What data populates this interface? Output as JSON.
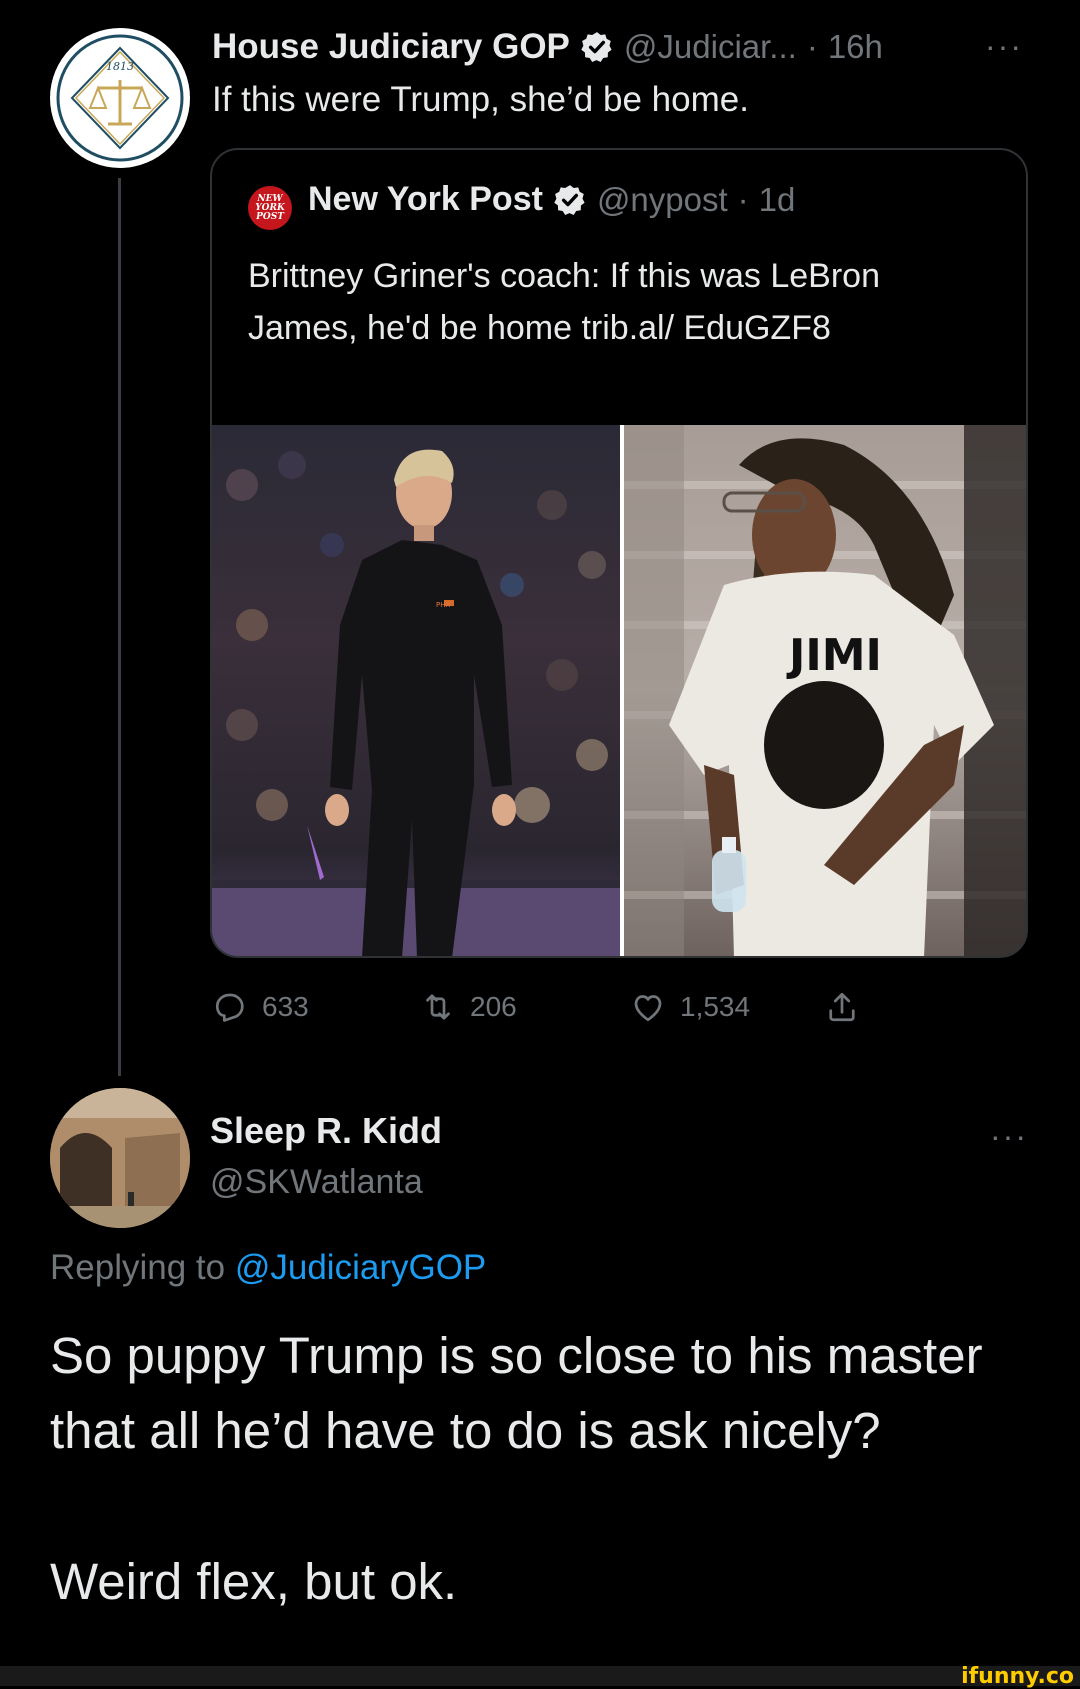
{
  "tweet": {
    "name": "House Judiciary GOP",
    "handle": "@Judiciar...",
    "separator": "·",
    "time": "16h",
    "more": "···",
    "text": "If this were Trump, she’d be home.",
    "avatar_year": "1813",
    "quote": {
      "name": "New York Post",
      "handle": "@nypost",
      "separator": "·",
      "time": "1d",
      "logo_lines": [
        "NEW",
        "YORK",
        "POST"
      ],
      "text": "Brittney Griner's coach: If this was LeBron James, he'd be home trib.al/ EduGZF8",
      "left_photo_jersey_text": "PHX",
      "right_photo_shirt_text": "JIMI"
    },
    "stats": {
      "replies": "633",
      "retweets": "206",
      "likes": "1,534"
    }
  },
  "reply": {
    "name": "Sleep R. Kidd",
    "handle": "@SKWatlanta",
    "more": "···",
    "replying_prefix": "Replying to",
    "replying_to": "@JudiciaryGOP",
    "text": "So puppy Trump is so close to his master that all he’d have to do is ask nicely?",
    "text2": "Weird flex, but ok."
  },
  "watermark": "ifunny.co",
  "colors": {
    "background": "#000000",
    "text": "#e7e9ea",
    "muted": "#71767b",
    "link": "#1d9bf0",
    "border": "#2f3336",
    "nypost_red": "#c4161c",
    "watermark": "#ffcc00"
  }
}
